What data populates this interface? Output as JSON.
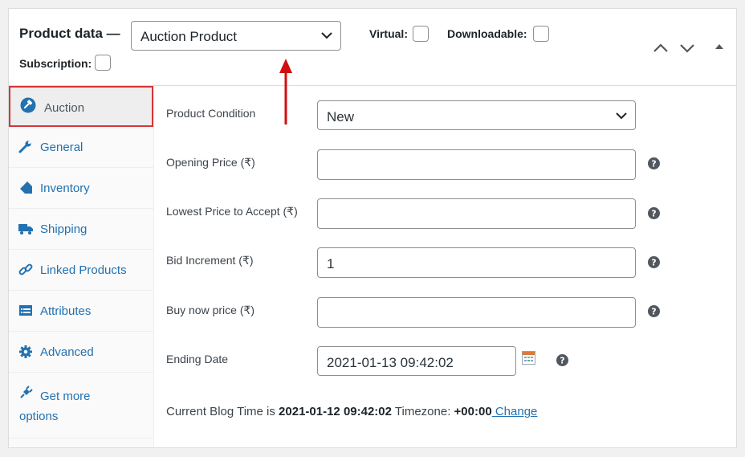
{
  "header": {
    "title": "Product data —",
    "product_type": {
      "selected": "Auction Product"
    },
    "virtual_label": "Virtual:",
    "virtual_checked": false,
    "downloadable_label": "Downloadable:",
    "downloadable_checked": false,
    "subscription_label": "Subscription:",
    "subscription_checked": false
  },
  "sidebar": {
    "items": [
      {
        "label": "Auction",
        "icon": "auction-gavel-icon",
        "active": true
      },
      {
        "label": "General",
        "icon": "wrench-icon",
        "active": false
      },
      {
        "label": "Inventory",
        "icon": "tag-icon",
        "active": false
      },
      {
        "label": "Shipping",
        "icon": "truck-icon",
        "active": false
      },
      {
        "label": "Linked Products",
        "icon": "link-icon",
        "active": false
      },
      {
        "label": "Attributes",
        "icon": "list-icon",
        "active": false
      },
      {
        "label": "Advanced",
        "icon": "gear-icon",
        "active": false
      },
      {
        "label": "Get more options",
        "icon": "plugin-icon",
        "active": false
      }
    ]
  },
  "fields": {
    "condition": {
      "label": "Product Condition",
      "value": "New"
    },
    "opening_price": {
      "label": "Opening Price (₹)",
      "value": ""
    },
    "lowest_price": {
      "label": "Lowest Price to Accept (₹)",
      "value": ""
    },
    "bid_increment": {
      "label": "Bid Increment (₹)",
      "value": "1"
    },
    "buy_now": {
      "label": "Buy now price (₹)",
      "value": ""
    },
    "ending_date": {
      "label": "Ending Date",
      "value": "2021-01-13 09:42:02"
    }
  },
  "blog_time": {
    "prefix": "Current Blog Time is ",
    "time": "2021-01-12 09:42:02",
    "tz_label": " Timezone: ",
    "tz": "+00:00",
    "change_link": " Change"
  },
  "colors": {
    "accent": "#2271b1",
    "highlight_border": "#d63638",
    "arrow": "#d10f0f"
  }
}
